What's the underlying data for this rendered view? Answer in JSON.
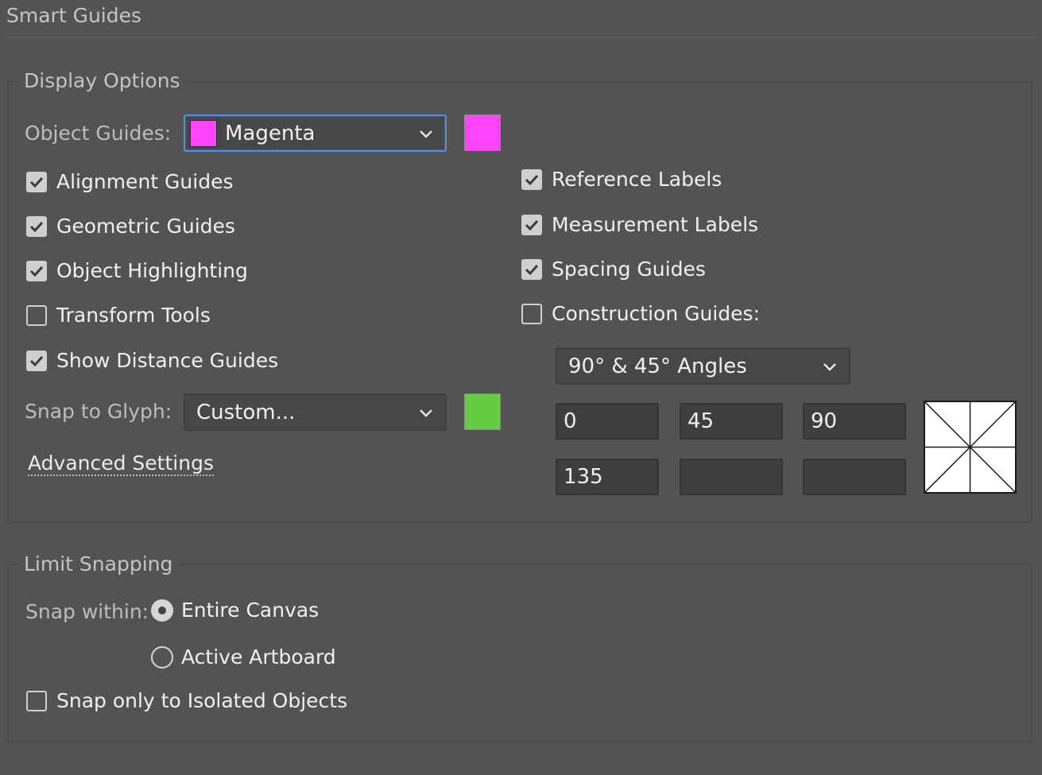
{
  "title": "Smart Guides",
  "display_options": {
    "legend": "Display Options",
    "object_guides_label": "Object Guides:",
    "object_guides_value": "Magenta",
    "object_guides_color": "#ff44ff",
    "left_checks": [
      {
        "label": "Alignment Guides",
        "checked": true
      },
      {
        "label": "Geometric Guides",
        "checked": true
      },
      {
        "label": "Object Highlighting",
        "checked": true
      },
      {
        "label": "Transform Tools",
        "checked": false
      },
      {
        "label": "Show Distance Guides",
        "checked": true
      }
    ],
    "right_checks": [
      {
        "label": "Reference Labels",
        "checked": true
      },
      {
        "label": "Measurement Labels",
        "checked": true
      },
      {
        "label": "Spacing Guides",
        "checked": true
      },
      {
        "label": "Construction Guides:",
        "checked": false
      }
    ],
    "snap_to_glyph_label": "Snap to Glyph:",
    "snap_to_glyph_value": "Custom...",
    "glyph_color": "#66cc44",
    "construction_angles_value": "90° & 45° Angles",
    "angles": [
      "0",
      "45",
      "90",
      "135",
      "",
      ""
    ],
    "advanced_settings_link": "Advanced Settings"
  },
  "limit_snapping": {
    "legend": "Limit Snapping",
    "snap_within_label": "Snap within:",
    "options": [
      {
        "label": "Entire Canvas",
        "selected": true
      },
      {
        "label": "Active Artboard",
        "selected": false
      }
    ],
    "isolated_label": "Snap only to Isolated Objects",
    "isolated_checked": false
  }
}
